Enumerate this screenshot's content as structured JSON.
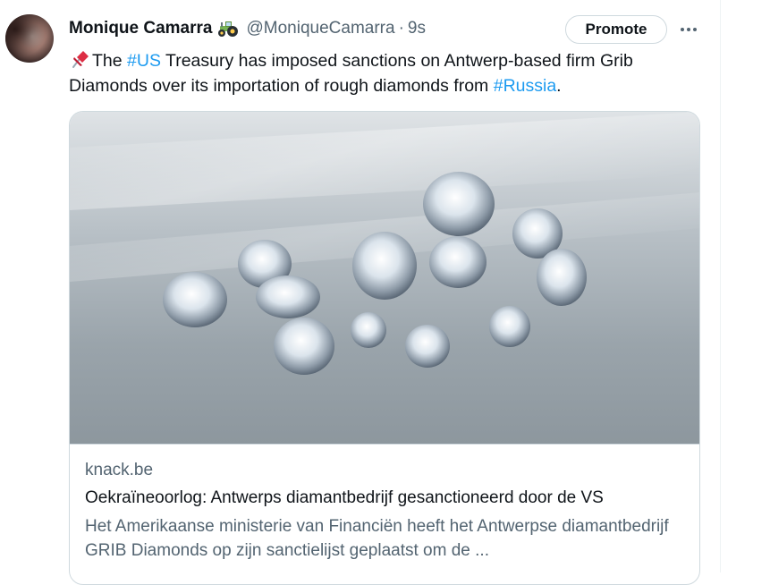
{
  "tweet": {
    "author_name": "Monique Camarra",
    "author_emoji": "tractor-emoji",
    "handle": "@MoniqueCamarra",
    "separator": "·",
    "timestamp": "9s",
    "promote_label": "Promote",
    "text": {
      "pin_emoji": "pushpin-emoji",
      "part1": "The ",
      "hashtag1": "#US",
      "part2": " Treasury has imposed sanctions on Antwerp-based firm Grib Diamonds over its importation of rough diamonds from ",
      "hashtag2": "#Russia",
      "part3": "."
    },
    "link_card": {
      "domain": "knack.be",
      "title": "Oekraïneoorlog: Antwerps diamantbedrijf gesanctioneerd door de VS",
      "description": "Het Amerikaanse ministerie van Financiën heeft het Antwerpse diamantbedrijf GRIB Diamonds op zijn sanctielijst geplaatst om de ..."
    }
  },
  "colors": {
    "link_blue": "#1d9bf0",
    "secondary_text": "#536471",
    "primary_text": "#0f1419",
    "border": "#cfd9de"
  }
}
